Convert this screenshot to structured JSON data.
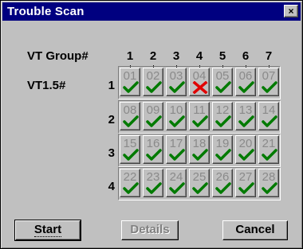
{
  "window": {
    "title": "Trouble Scan",
    "close_label": "×"
  },
  "labels": {
    "vt_group": "VT Group#",
    "vt15": "VT1.5#"
  },
  "columns": [
    "1",
    "2",
    "3",
    "4",
    "5",
    "6",
    "7"
  ],
  "rows": [
    "1",
    "2",
    "3",
    "4"
  ],
  "cells": [
    {
      "n": "01",
      "s": "ok"
    },
    {
      "n": "02",
      "s": "ok"
    },
    {
      "n": "03",
      "s": "ok"
    },
    {
      "n": "04",
      "s": "fail"
    },
    {
      "n": "05",
      "s": "ok"
    },
    {
      "n": "06",
      "s": "ok"
    },
    {
      "n": "07",
      "s": "ok"
    },
    {
      "n": "08",
      "s": "ok"
    },
    {
      "n": "09",
      "s": "ok"
    },
    {
      "n": "10",
      "s": "ok"
    },
    {
      "n": "11",
      "s": "ok"
    },
    {
      "n": "12",
      "s": "ok"
    },
    {
      "n": "13",
      "s": "ok"
    },
    {
      "n": "14",
      "s": "ok"
    },
    {
      "n": "15",
      "s": "ok"
    },
    {
      "n": "16",
      "s": "ok"
    },
    {
      "n": "17",
      "s": "ok"
    },
    {
      "n": "18",
      "s": "ok"
    },
    {
      "n": "19",
      "s": "ok"
    },
    {
      "n": "20",
      "s": "ok"
    },
    {
      "n": "21",
      "s": "ok"
    },
    {
      "n": "22",
      "s": "ok"
    },
    {
      "n": "23",
      "s": "ok"
    },
    {
      "n": "24",
      "s": "ok"
    },
    {
      "n": "25",
      "s": "ok"
    },
    {
      "n": "26",
      "s": "ok"
    },
    {
      "n": "27",
      "s": "ok"
    },
    {
      "n": "28",
      "s": "ok"
    }
  ],
  "status_icons": {
    "ok": "check-icon",
    "fail": "x-icon"
  },
  "colors": {
    "ok": "#007a00",
    "fail": "#e00000",
    "title_bg": "#000080"
  },
  "buttons": {
    "start": "Start",
    "details": "Details",
    "cancel": "Cancel"
  }
}
